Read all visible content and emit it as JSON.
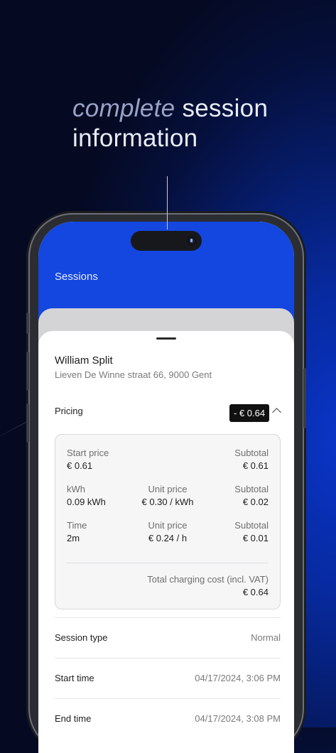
{
  "headline": {
    "emphasis": "complete",
    "rest_line1": " session",
    "line2": "information"
  },
  "screen": {
    "title": "Sessions"
  },
  "session": {
    "user_name": "William Split",
    "address": "Lieven De Winne straat 66, 9000 Gent"
  },
  "pricing": {
    "label": "Pricing",
    "badge": "- € 0.64",
    "start_price": {
      "label": "Start price",
      "value": "€ 0.61",
      "subtotal_label": "Subtotal",
      "subtotal": "€ 0.61"
    },
    "energy": {
      "label": "kWh",
      "value": "0.09 kWh",
      "unit_price_label": "Unit price",
      "unit_price": "€ 0.30 / kWh",
      "subtotal_label": "Subtotal",
      "subtotal": "€ 0.02"
    },
    "time": {
      "label": "Time",
      "value": "2m",
      "unit_price_label": "Unit price",
      "unit_price": "€ 0.24 / h",
      "subtotal_label": "Subtotal",
      "subtotal": "€ 0.01"
    },
    "total": {
      "label": "Total charging cost (incl. VAT)",
      "value": "€ 0.64"
    }
  },
  "details": [
    {
      "label": "Session type",
      "value": "Normal"
    },
    {
      "label": "Start time",
      "value": "04/17/2024, 3:06 PM"
    },
    {
      "label": "End time",
      "value": "04/17/2024, 3:08 PM"
    }
  ],
  "colors": {
    "accent_blue": "#1446e0",
    "badge_bg": "#111111"
  }
}
